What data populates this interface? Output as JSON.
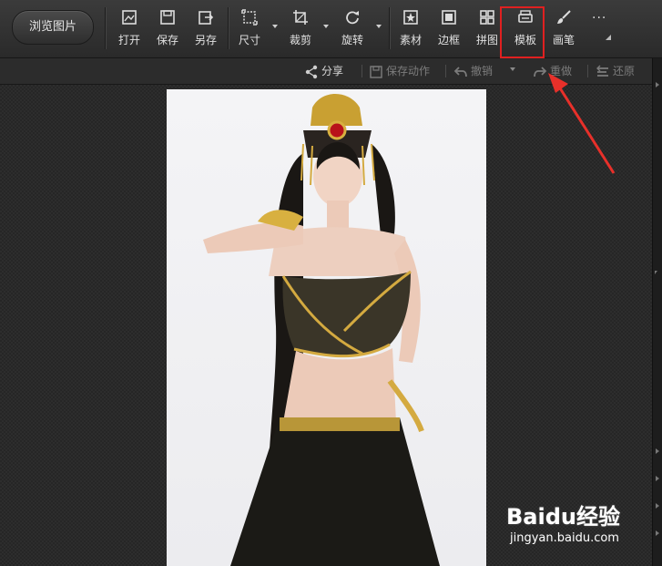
{
  "toolbar": {
    "browse_label": "浏览图片",
    "tools": [
      {
        "label": "打开",
        "icon": "open-image-icon"
      },
      {
        "label": "保存",
        "icon": "save-icon"
      },
      {
        "label": "另存",
        "icon": "save-as-icon"
      },
      {
        "label": "尺寸",
        "icon": "resize-icon"
      },
      {
        "label": "裁剪",
        "icon": "crop-icon"
      },
      {
        "label": "旋转",
        "icon": "rotate-icon"
      },
      {
        "label": "素材",
        "icon": "sticker-icon"
      },
      {
        "label": "边框",
        "icon": "frame-icon"
      },
      {
        "label": "拼图",
        "icon": "collage-icon"
      },
      {
        "label": "模板",
        "icon": "template-icon"
      },
      {
        "label": "画笔",
        "icon": "brush-icon"
      }
    ],
    "more_label": "···",
    "highlighted_tool": "模板",
    "highlight_color": "#e02020"
  },
  "actionbar": {
    "share": "分享",
    "save_action": "保存动作",
    "undo": "撤销",
    "redo": "重做",
    "restore": "还原"
  },
  "canvas": {
    "background_color": "#262626",
    "photo_description": "portrait photo"
  },
  "watermark": {
    "logo": "Baidu经验",
    "url": "jingyan.baidu.com"
  }
}
